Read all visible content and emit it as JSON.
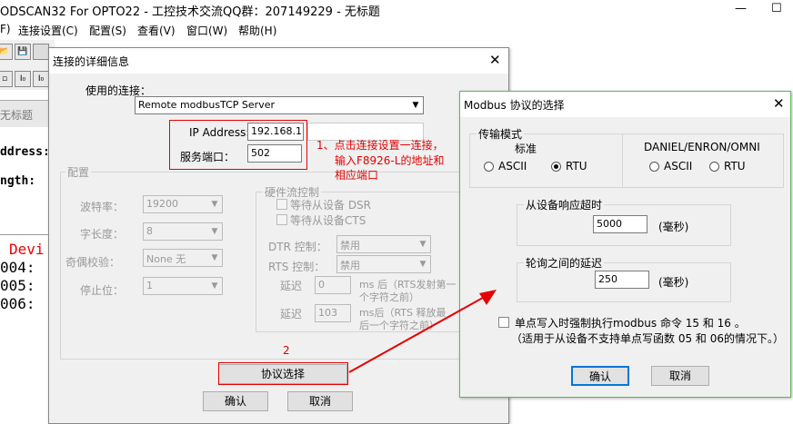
{
  "app": {
    "title": "ODSCAN32 For OPTO22 - 工控技术交流QQ群：207149229 - 无标题",
    "minimize": "—",
    "maximize": "☐"
  },
  "menu": [
    "F)",
    "连接设置(C)",
    "配置(S)",
    "查看(V)",
    "窗口(W)",
    "帮助(H)"
  ],
  "toolbar": {
    "row2": [
      "",
      "I₀",
      "I₀",
      "I₀"
    ]
  },
  "bg": {
    "child_title": "无标题",
    "address_label": "ddress:",
    "length_label": "ngth:",
    "device_text": "Devi",
    "lines": [
      "004:",
      "005:",
      "006:"
    ]
  },
  "conn_dialog": {
    "title": "连接的详细信息",
    "close": "✕",
    "use_conn_label": "使用的连接：",
    "use_conn_value": "Remote modbusTCP Server",
    "ip_label": "IP Address:",
    "ip_value": "192.168.1.1",
    "port_label": "服务端口：",
    "port_value": "502",
    "config_group": "配置",
    "baud_label": "波特率：",
    "baud_value": "19200",
    "wordlen_label": "字长度：",
    "wordlen_value": "8",
    "parity_label": "奇偶校验：",
    "parity_value": "None 无",
    "stop_label": "停止位：",
    "stop_value": "1",
    "flow_group": "硬件流控制",
    "dsr_label": "等待从设备 DSR",
    "cts_label": "等待从设备CTS",
    "dtr_label": "DTR 控制：",
    "dtr_value": "禁用",
    "rts_label": "RTS 控制：",
    "rts_value": "禁用",
    "delay1_label": "延迟",
    "delay1_value": "0",
    "delay1_note1": "ms 后（RTS发射第一",
    "delay1_note2": "个字符之前）",
    "delay2_label": "延迟",
    "delay2_value": "103",
    "delay2_note1": "ms后（RTS 释放最",
    "delay2_note2": "后一个字符之前）",
    "protocol_btn": "协议选择",
    "ok_btn": "确认",
    "cancel_btn": "取消"
  },
  "annotation": {
    "note1_line1": "1、点击连接设置一连接，",
    "note1_line2": "输入F8926-L的地址和",
    "note1_line3": "相应端口",
    "note2": "2",
    "color": "#e60000"
  },
  "proto_dialog": {
    "title": "Modbus 协议的选择",
    "close": "✕",
    "transmission_group": "传输模式",
    "standard_label": "标准",
    "daniel_label": "DANIEL/ENRON/OMNI",
    "ascii_label": "ASCII",
    "rtu_label": "RTU",
    "ascii2_label": "ASCII",
    "rtu2_label": "RTU",
    "timeout_group": "从设备响应超时",
    "timeout_value": "5000",
    "timeout_unit": "(毫秒)",
    "poll_group": "轮询之间的延迟",
    "poll_value": "250",
    "poll_unit": "(毫秒)",
    "force_label": "单点写入时强制执行modbus 命令 15 和 16 。",
    "force_note": "（适用于从设备不支持单点写函数 05 和 06的情况下。）",
    "ok_btn": "确认",
    "cancel_btn": "取消",
    "border_color": "#4caf50"
  }
}
